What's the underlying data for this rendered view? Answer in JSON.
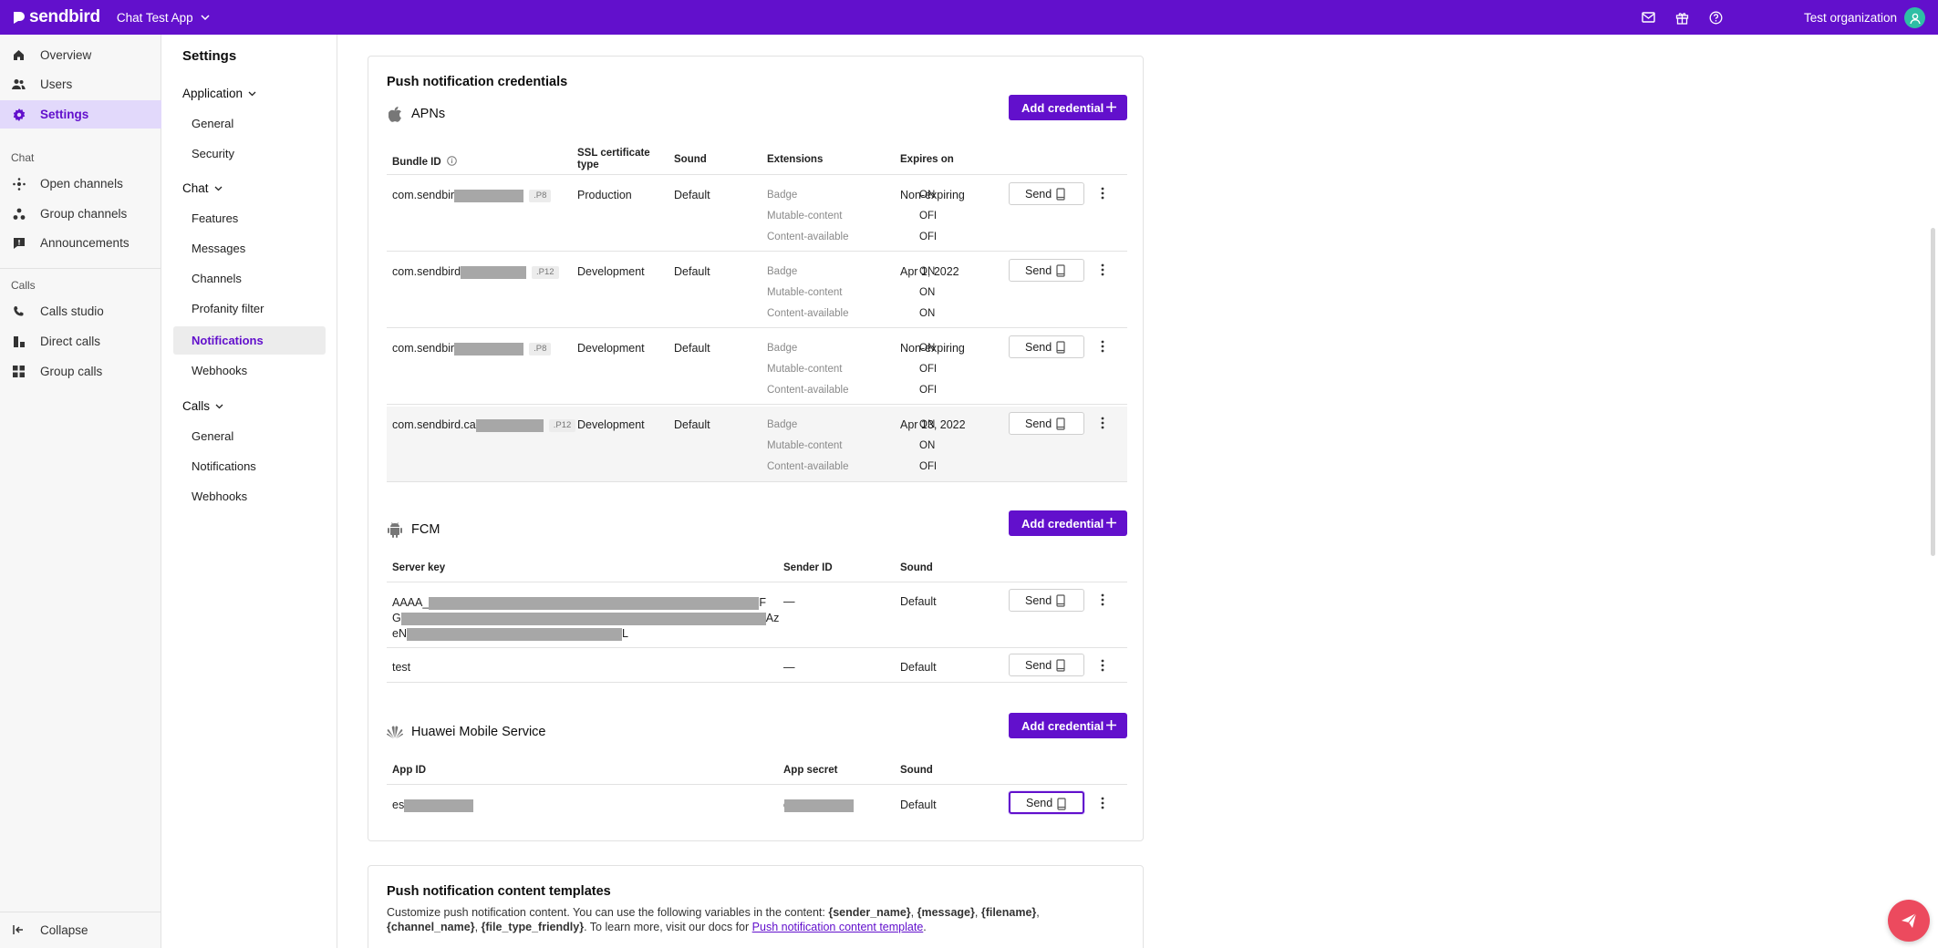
{
  "topbar": {
    "brand": "sendbird",
    "app_name": "Chat Test App",
    "organization": "Test organization",
    "icons": [
      "mail-icon",
      "gift-icon",
      "help-icon",
      "user-icon"
    ]
  },
  "leftnav": {
    "items": [
      {
        "label": "Overview",
        "icon": "home-icon"
      },
      {
        "label": "Users",
        "icon": "users-icon"
      },
      {
        "label": "Settings",
        "icon": "gear-icon"
      }
    ],
    "chat_section": "Chat",
    "chat_items": [
      {
        "label": "Open channels",
        "icon": "open-channel-icon"
      },
      {
        "label": "Group channels",
        "icon": "group-channel-icon"
      },
      {
        "label": "Announcements",
        "icon": "announcement-icon"
      }
    ],
    "calls_section": "Calls",
    "calls_items": [
      {
        "label": "Calls studio",
        "icon": "phone-icon"
      },
      {
        "label": "Direct calls",
        "icon": "direct-call-icon"
      },
      {
        "label": "Group calls",
        "icon": "grid-icon"
      }
    ],
    "collapse": "Collapse"
  },
  "settings": {
    "title": "Settings",
    "application_group": "Application",
    "application_items": [
      "General",
      "Security"
    ],
    "chat_group": "Chat",
    "chat_items": [
      "Features",
      "Messages",
      "Channels",
      "Profanity filter",
      "Notifications",
      "Webhooks"
    ],
    "calls_group": "Calls",
    "calls_items": [
      "General",
      "Notifications",
      "Webhooks"
    ]
  },
  "credentials": {
    "title": "Push notification credentials",
    "add_label": "Add credential",
    "send_label": "Send",
    "apns": {
      "name": "APNs",
      "headers": {
        "bundle_id": "Bundle ID",
        "ssl": "SSL certificate type",
        "sound": "Sound",
        "extensions": "Extensions",
        "expires": "Expires on"
      },
      "ext_labels": {
        "badge": "Badge",
        "mutable": "Mutable-content",
        "content": "Content-available"
      },
      "rows": [
        {
          "bundle_prefix": "com.sendbir",
          "tag": ".P8",
          "type": "Production",
          "sound": "Default",
          "badge": "ON",
          "mutable": "OFF",
          "content": "OFF",
          "expires": "Non-expiring"
        },
        {
          "bundle_prefix": "com.sendbird",
          "tag": ".P12",
          "type": "Development",
          "sound": "Default",
          "badge": "ON",
          "mutable": "ON",
          "content": "ON",
          "expires": "Apr 1, 2022"
        },
        {
          "bundle_prefix": "com.sendbir",
          "tag": ".P8",
          "type": "Development",
          "sound": "Default",
          "badge": "ON",
          "mutable": "OFF",
          "content": "OFF",
          "expires": "Non-expiring"
        },
        {
          "bundle_prefix": "com.sendbird.ca",
          "tag": ".P12",
          "type": "Development",
          "sound": "Default",
          "badge": "ON",
          "mutable": "ON",
          "content": "OFF",
          "expires": "Apr 13, 2022"
        }
      ]
    },
    "fcm": {
      "name": "FCM",
      "headers": {
        "server_key": "Server key",
        "sender_id": "Sender ID",
        "sound": "Sound"
      },
      "rows": [
        {
          "key_line1_start": "AAAA_",
          "key_line1_end": "F",
          "key_line2_start": "G",
          "key_line2_end": "Az",
          "key_line3_start": "eN",
          "key_line3_end": "L",
          "sender": "—",
          "sound": "Default"
        },
        {
          "key": "test",
          "sender": "—",
          "sound": "Default"
        }
      ]
    },
    "hms": {
      "name": "Huawei Mobile Service",
      "headers": {
        "app_id": "App ID",
        "app_secret": "App secret",
        "sound": "Sound"
      },
      "rows": [
        {
          "app_id_prefix": "es",
          "secret_prefix": "c",
          "sound": "Default"
        }
      ]
    }
  },
  "templates": {
    "title": "Push notification content templates",
    "desc_part1": "Customize push notification content. You can use the following variables in the content: ",
    "var1": "{sender_name}",
    "sep1": ", ",
    "var2": "{message}",
    "sep2": ", ",
    "var3": "{filename}",
    "sep3": ", ",
    "var4": "{channel_name}",
    "sep4": ", ",
    "var5": "{file_type_friendly}",
    "desc_part2": ". To learn more, visit our docs for ",
    "link": "Push notification content template",
    "desc_end": "."
  }
}
